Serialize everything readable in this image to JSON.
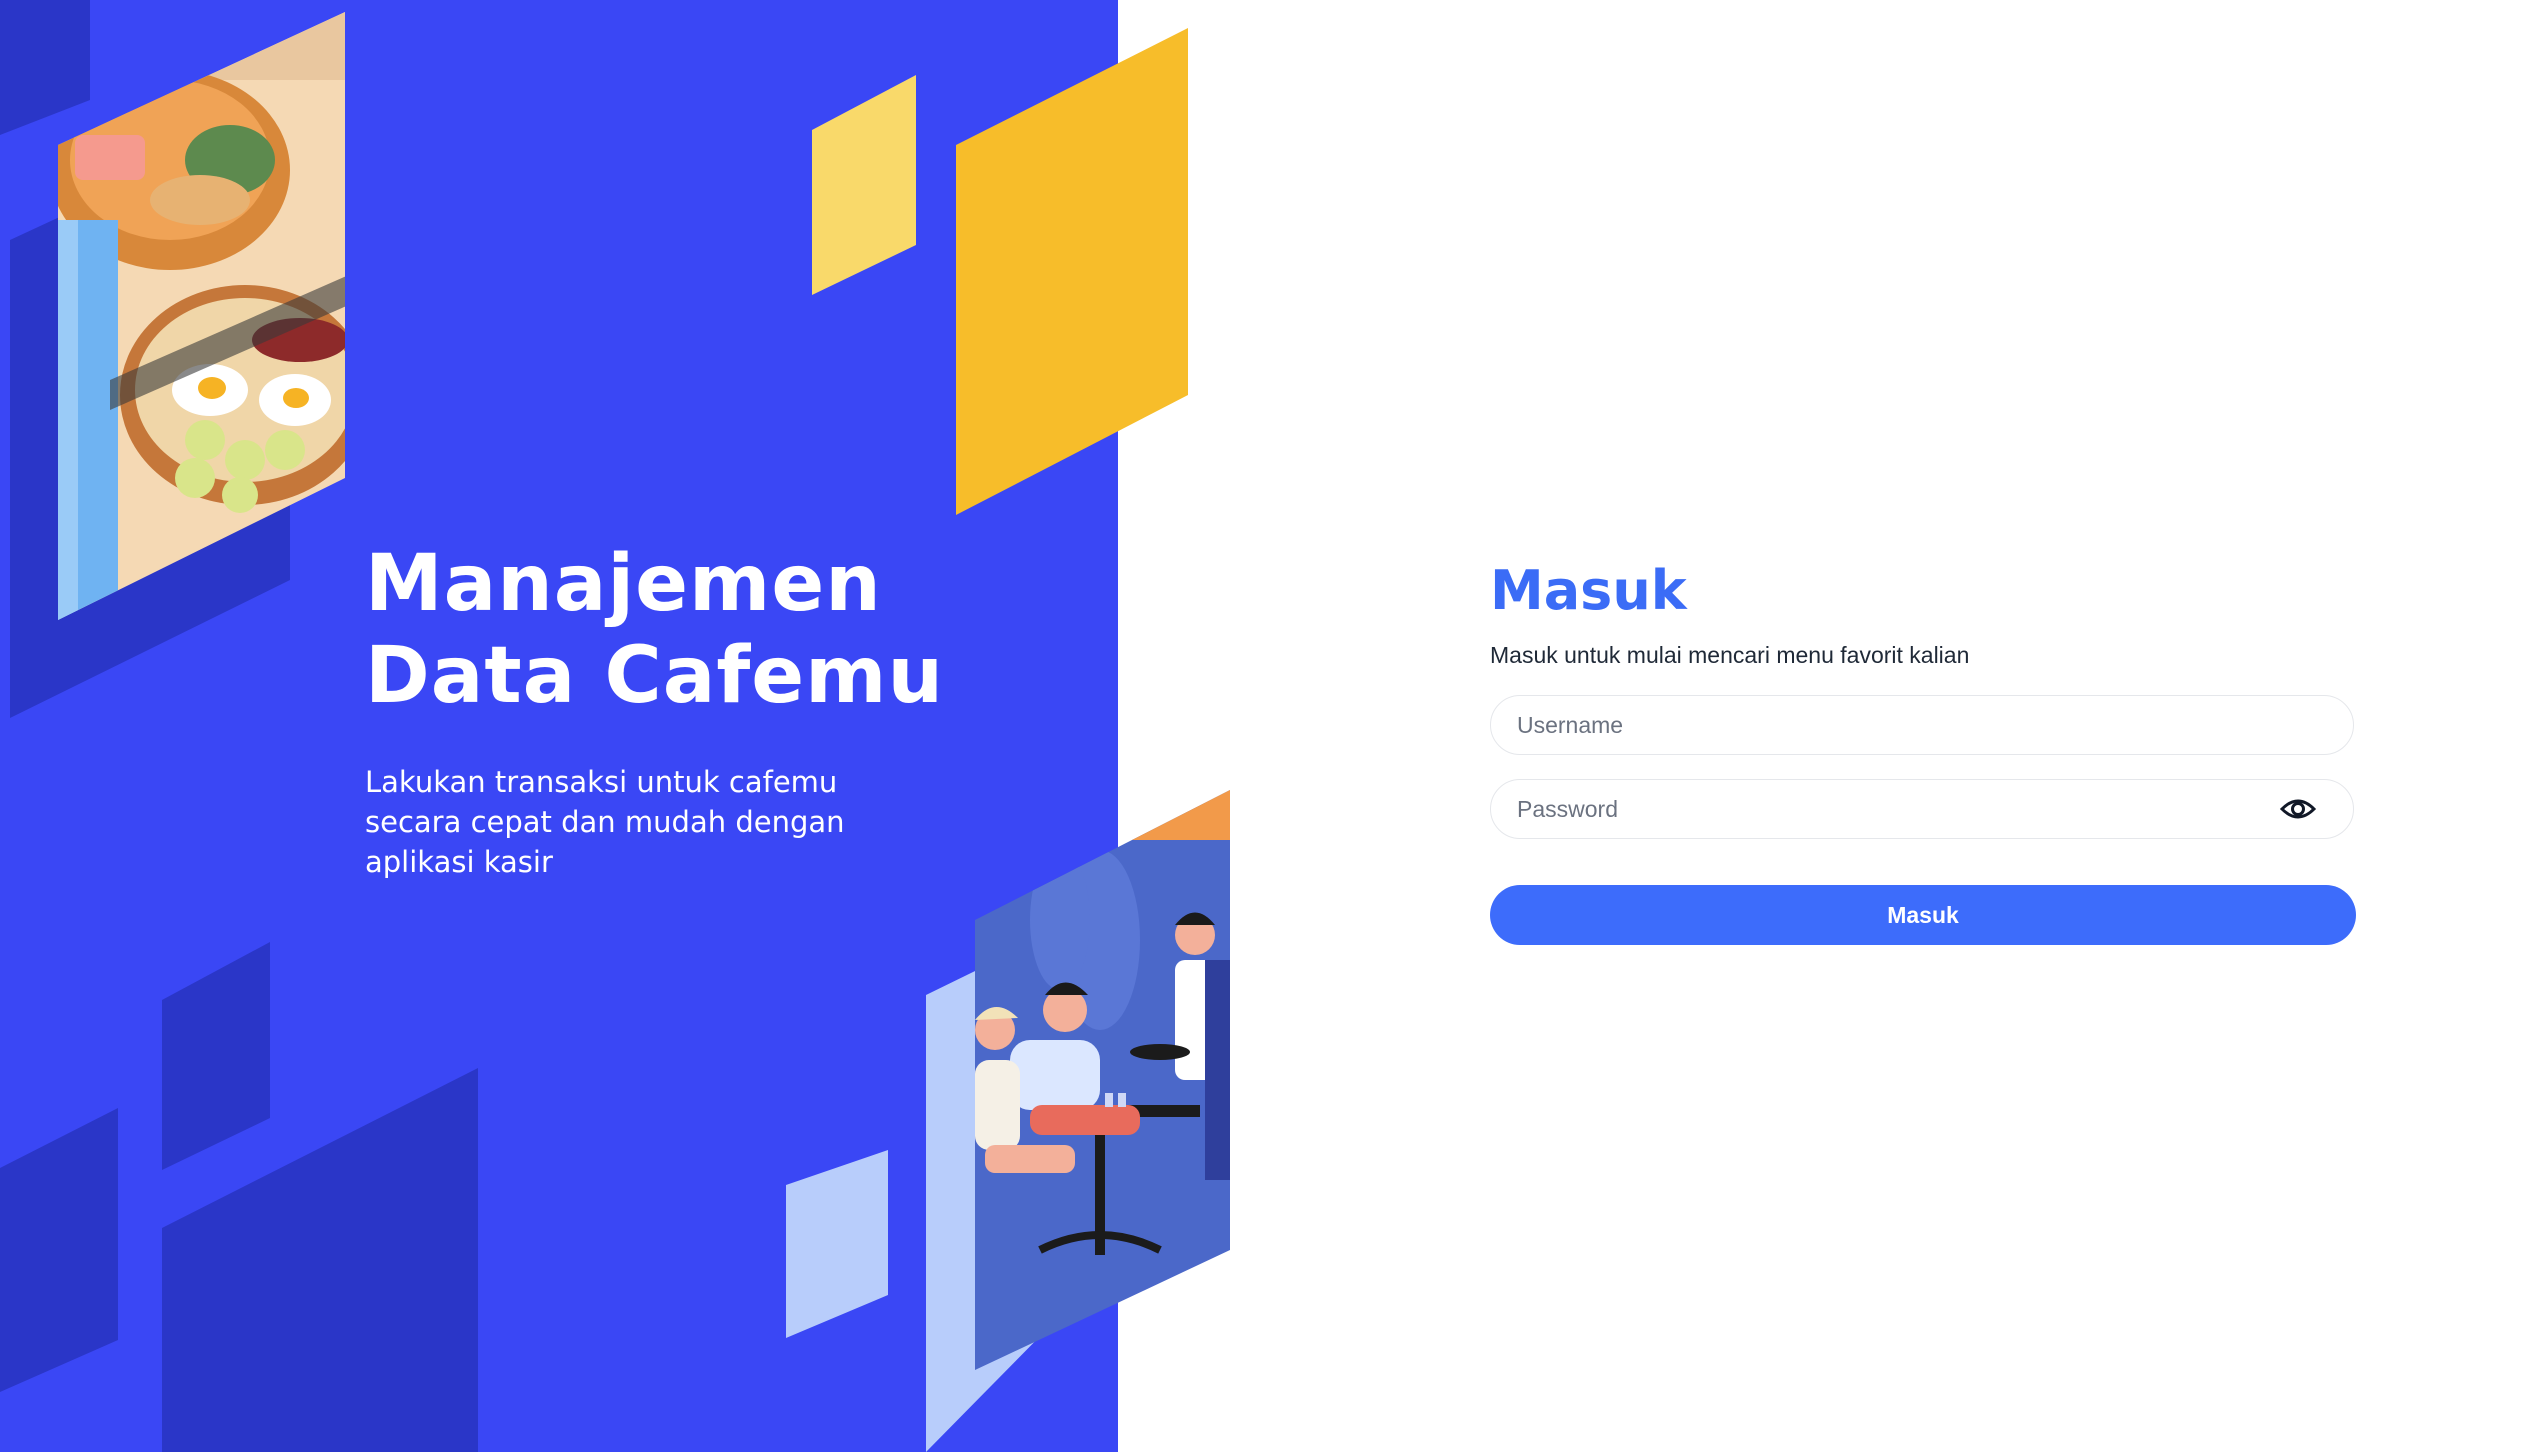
{
  "hero": {
    "title_line1": "Manajemen",
    "title_line2": "Data Cafemu",
    "subtitle": "Lakukan transaksi untuk cafemu secara cepat dan mudah dengan aplikasi kasir"
  },
  "login": {
    "title": "Masuk",
    "subtitle": "Masuk untuk mulai mencari menu favorit kalian",
    "username_placeholder": "Username",
    "password_placeholder": "Password",
    "submit_label": "Masuk"
  },
  "illustrations": {
    "top_left": "food-bowls-illustration",
    "bottom_right": "cafe-waiter-serving-customers-illustration"
  },
  "icons": {
    "password_toggle": "eye-icon"
  },
  "colors": {
    "hero_background": "#3a47f5",
    "accent_blue": "#3b6cf6",
    "button_blue": "#3d6cfb",
    "yellow_dark": "#f7bd2a",
    "yellow_light": "#f9d96a",
    "light_blue": "#b8cdfb"
  }
}
